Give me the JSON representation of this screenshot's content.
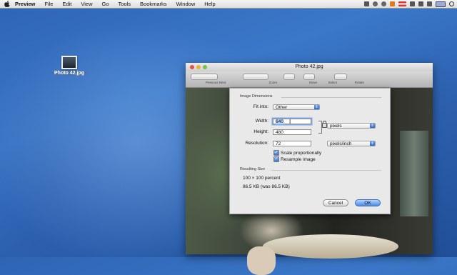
{
  "menubar": {
    "items": [
      "Preview",
      "File",
      "Edit",
      "View",
      "Go",
      "Tools",
      "Bookmarks",
      "Window",
      "Help"
    ]
  },
  "desktop": {
    "icon_label": "Photo 42.jpg"
  },
  "window": {
    "title": "Photo 42.jpg",
    "toolbar_labels": [
      "Previous",
      "Next",
      "Zoom",
      "Move",
      "Select",
      "Rotate"
    ]
  },
  "dialog": {
    "group_title": "Image Dimensions",
    "fit_into_label": "Fit into:",
    "fit_into_value": "Other",
    "width_label": "Width:",
    "width_value": "640",
    "height_label": "Height:",
    "height_value": "480",
    "size_unit": "pixels",
    "resolution_label": "Resolution:",
    "resolution_value": "72",
    "resolution_unit": "pixels/inch",
    "scale_label": "Scale proportionally",
    "scale_checked": true,
    "resample_label": "Resample image",
    "resample_checked": true,
    "resulting_title": "Resulting Size",
    "result_percent": "100 × 100 percent",
    "result_size": "86.5 KB (was 86.5 KB)",
    "cancel_label": "Cancel",
    "ok_label": "OK"
  }
}
